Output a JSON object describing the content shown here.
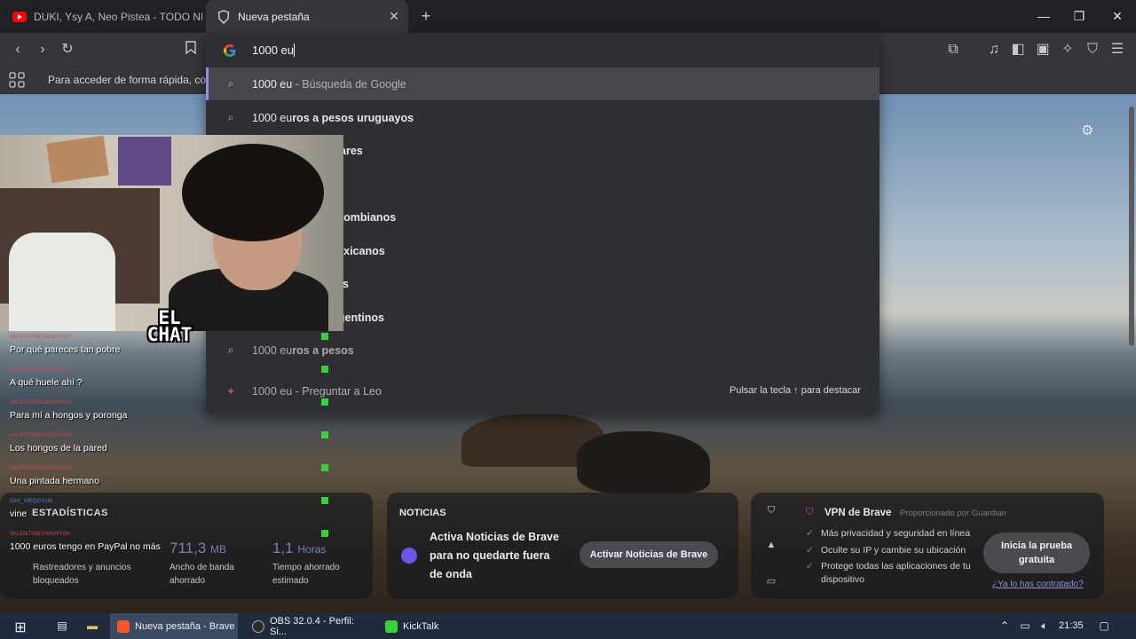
{
  "tabs": [
    {
      "title": "DUKI, Ysy A, Neo Pistea - TODO NEGRO",
      "icon": "youtube-icon"
    },
    {
      "title": "Nueva pestaña",
      "icon": "brave-shield-icon",
      "active": true
    }
  ],
  "toolbar": {
    "omnibox_text": "1000 eu"
  },
  "bookmarks_bar": {
    "hint": "Para acceder de forma rápida, coloca"
  },
  "suggestions": [
    {
      "typed": "1000 eu",
      "rest": "",
      "suffix": "- Búsqueda de Google"
    },
    {
      "typed": "1000 eu",
      "rest": "ros a pesos uruguayos",
      "suffix": ""
    },
    {
      "typed": "",
      "rest": "ares",
      "suffix": ""
    },
    {
      "typed": "",
      "rest": "",
      "suffix": ""
    },
    {
      "typed": "",
      "rest": "os colombianos",
      "suffix": ""
    },
    {
      "typed": "",
      "rest": "os mexicanos",
      "suffix": ""
    },
    {
      "typed": "",
      "rest": "s",
      "suffix": ""
    },
    {
      "typed": "",
      "rest": "os argentinos",
      "suffix": ""
    },
    {
      "typed": "1000 eu",
      "rest": "ros a pesos",
      "suffix": ""
    },
    {
      "typed": "1000 eu",
      "rest": "",
      "suffix": "- Preguntar a Leo"
    }
  ],
  "suggestion_hint": "Pulsar la tecla ↑ para destacar",
  "stats": {
    "title": "ESTADÍSTICAS",
    "items": [
      {
        "value": "",
        "unit": "",
        "label1": "Rastreadores y anuncios",
        "label2": "bloqueados"
      },
      {
        "value": "711,3",
        "unit": "MB",
        "label1": "Ancho de banda",
        "label2": "ahorrado"
      },
      {
        "value": "1,1",
        "unit": "Horas",
        "label1": "Tiempo ahorrado",
        "label2": "estimado"
      }
    ]
  },
  "news": {
    "title": "NOTICIAS",
    "text_lines": [
      "Activa Noticias de Brave",
      "para no quedarte fuera",
      "de onda"
    ],
    "button": "Activar Noticias de Brave"
  },
  "vpn": {
    "title": "VPN de Brave",
    "provider": "Proporcionado por  Guardian",
    "features": [
      "Más privacidad y seguridad en línea",
      "Oculte su IP y cambie su ubicación",
      "Protege todas las aplicaciones de tu",
      "dispositivo"
    ],
    "button_line1": "Inicia la prueba",
    "button_line2": "gratuita",
    "link": "¿Ya lo has contratado?"
  },
  "overlay": {
    "el_chat_line1": "EL",
    "el_chat_line2": "CHAT",
    "messages": [
      {
        "user": "VALENTINEUWUNYAH",
        "text": "Por qué pareces tan pobre"
      },
      {
        "user": "VALENTINEUWUNYAH",
        "text": "A qué huele ahí ?"
      },
      {
        "user": "VALENTINEUWUNYAH",
        "text": "Para mí a hongos y poronga"
      },
      {
        "user": "VALENTINEUWUNYAH",
        "text": "Los hongos de la pared"
      },
      {
        "user": "VALENTINEUWUNYAH",
        "text": "Una pintada hermano"
      },
      {
        "user": "SAY_URQGYUA",
        "text": "vine"
      },
      {
        "user": "VALENTINEUWUNYAH",
        "text": "1000 euros tengo en PayPal no más"
      }
    ]
  },
  "taskbar": {
    "items": [
      {
        "label": "Nueva pestaña - Brave",
        "active": true
      },
      {
        "label": "OBS 32.0.4 - Perfil: Si..."
      },
      {
        "label": "KickTalk"
      }
    ],
    "clock": "21:35"
  },
  "colors": {
    "accent": "#8b90e6",
    "chat_badge": "#38d139",
    "chat_user": "#c94a5a",
    "vpn_brand": "#b53fd0"
  }
}
